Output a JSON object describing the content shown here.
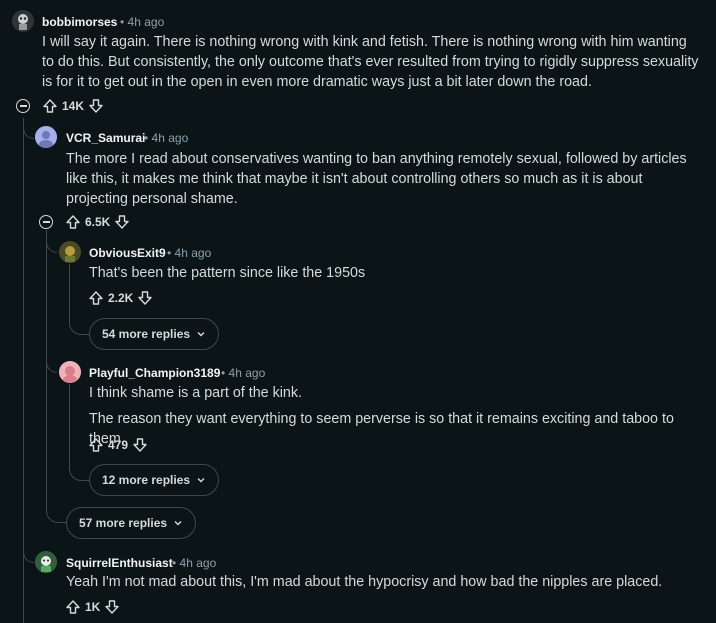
{
  "comments": [
    {
      "username": "bobbimorses",
      "time": "4h ago",
      "body": "I will say it again. There is nothing wrong with kink and fetish. There is nothing wrong with him wanting to do this. But consistently, the only outcome that's ever resulted from trying to rigidly suppress sexuality is for it to get out in the open in even more dramatic ways just a bit later down the road.",
      "score": "14K"
    },
    {
      "username": "VCR_Samurai",
      "time": "4h ago",
      "body": "The more I read about conservatives wanting to ban anything remotely sexual, followed by articles like this, it makes me think that maybe it isn't about controlling others so much as it is about projecting personal shame.",
      "score": "6.5K"
    },
    {
      "username": "ObviousExit9",
      "time": "4h ago",
      "body": "That's been the pattern since like the 1950s",
      "score": "2.2K",
      "more_replies": "54 more replies"
    },
    {
      "username": "Playful_Champion3189",
      "time": "4h ago",
      "body_p1": "I think shame is a part of the kink.",
      "body_p2": "The reason they want everything to seem perverse is so that it remains exciting and taboo to them.",
      "score": "479",
      "more_replies": "12 more replies"
    },
    {
      "username": "SquirrelEnthusiast",
      "time": "4h ago",
      "body": "Yeah I'm not mad about this, I'm mad about the hypocrisy and how bad the nipples are placed.",
      "score": "1K"
    }
  ],
  "vcr_more_replies": "57 more replies",
  "separator": "•",
  "colors": {
    "background": "#0b1416",
    "text": "#d7dadc",
    "meta": "#8ba2ad",
    "thread": "#3e4a4f"
  }
}
